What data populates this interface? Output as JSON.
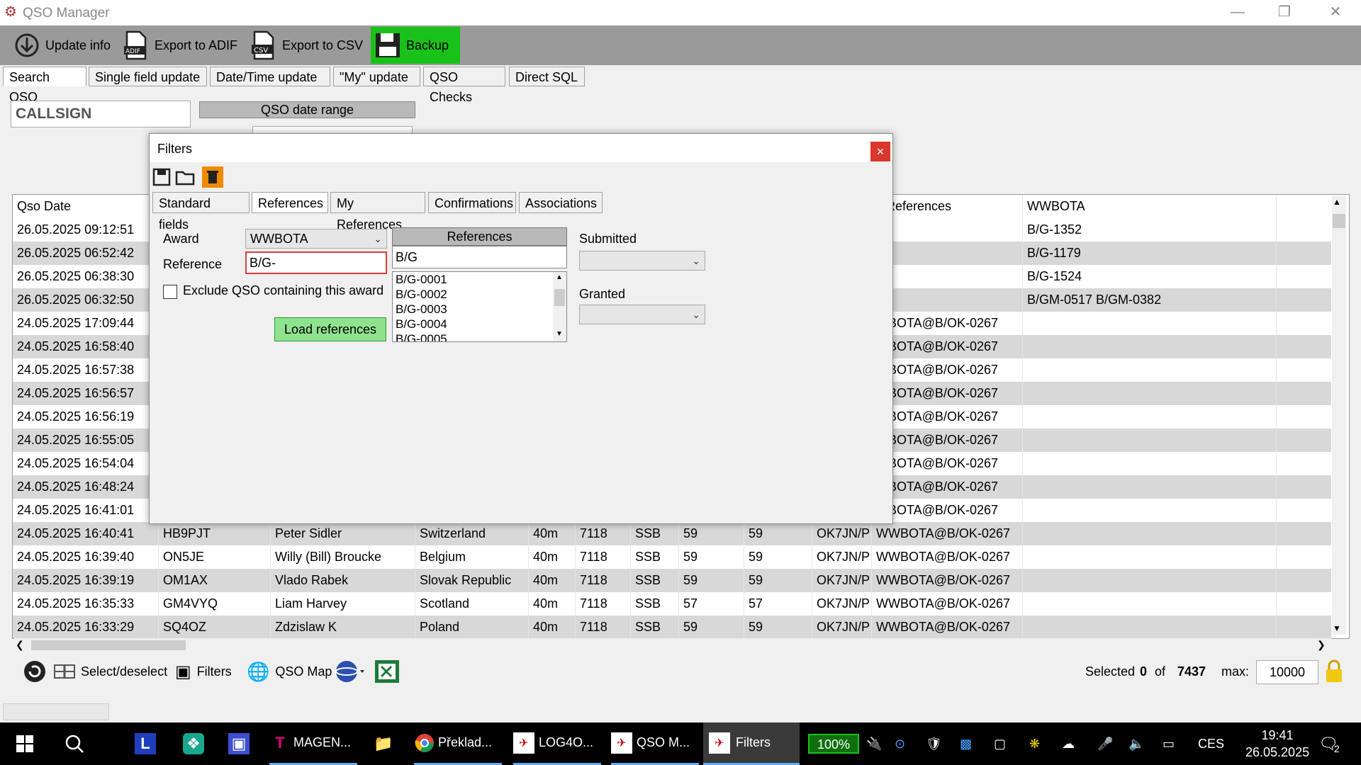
{
  "app": {
    "title": "QSO Manager"
  },
  "toolbar": {
    "update_info": "Update info",
    "export_adif": "Export to ADIF",
    "export_csv": "Export to CSV",
    "backup": "Backup",
    "backup_color": "#19c219"
  },
  "tabs": [
    "Search QSO",
    "Single field update",
    "Date/Time update",
    "\"My\" update",
    "QSO Checks",
    "Direct SQL"
  ],
  "search": {
    "callsign_placeholder": "CALLSIGN",
    "date_range": "QSO date range"
  },
  "grid": {
    "columns": [
      "Qso Date",
      "",
      "",
      "",
      "",
      "",
      "",
      "",
      "",
      "",
      "y References",
      "WWBOTA"
    ],
    "rows": [
      [
        "26.05.2025 09:12:51",
        "",
        "",
        "",
        "",
        "",
        "",
        "",
        "",
        "",
        "",
        "B/G-1352"
      ],
      [
        "26.05.2025 06:52:42",
        "",
        "",
        "",
        "",
        "",
        "",
        "",
        "",
        "",
        "",
        "B/G-1179"
      ],
      [
        "26.05.2025 06:38:30",
        "",
        "",
        "",
        "",
        "",
        "",
        "",
        "",
        "",
        "",
        "B/G-1524"
      ],
      [
        "26.05.2025 06:32:50",
        "",
        "",
        "",
        "",
        "",
        "",
        "",
        "",
        "",
        "",
        "B/GM-0517 B/GM-0382"
      ],
      [
        "24.05.2025 17:09:44",
        "",
        "",
        "",
        "",
        "",
        "",
        "",
        "",
        "",
        "WBOTA@B/OK-0267",
        ""
      ],
      [
        "24.05.2025 16:58:40",
        "",
        "",
        "",
        "",
        "",
        "",
        "",
        "",
        "",
        "WBOTA@B/OK-0267",
        ""
      ],
      [
        "24.05.2025 16:57:38",
        "",
        "",
        "",
        "",
        "",
        "",
        "",
        "",
        "",
        "WBOTA@B/OK-0267",
        ""
      ],
      [
        "24.05.2025 16:56:57",
        "",
        "",
        "",
        "",
        "",
        "",
        "",
        "",
        "",
        "WBOTA@B/OK-0267",
        ""
      ],
      [
        "24.05.2025 16:56:19",
        "",
        "",
        "",
        "",
        "",
        "",
        "",
        "",
        "",
        "WBOTA@B/OK-0267",
        ""
      ],
      [
        "24.05.2025 16:55:05",
        "",
        "",
        "",
        "",
        "",
        "",
        "",
        "",
        "",
        "WBOTA@B/OK-0267",
        ""
      ],
      [
        "24.05.2025 16:54:04",
        "",
        "",
        "",
        "",
        "",
        "",
        "",
        "",
        "",
        "WBOTA@B/OK-0267",
        ""
      ],
      [
        "24.05.2025 16:48:24",
        "",
        "",
        "",
        "",
        "",
        "",
        "",
        "",
        "",
        "WBOTA@B/OK-0267",
        ""
      ],
      [
        "24.05.2025 16:41:01",
        "",
        "",
        "",
        "",
        "",
        "",
        "",
        "",
        "",
        "WBOTA@B/OK-0267",
        ""
      ],
      [
        "24.05.2025 16:40:41",
        "HB9PJT",
        "Peter Sidler",
        "Switzerland",
        "40m",
        "7118",
        "SSB",
        "59",
        "59",
        "OK7JN/P",
        "WWBOTA@B/OK-0267",
        ""
      ],
      [
        "24.05.2025 16:39:40",
        "ON5JE",
        "Willy (Bill) Broucke",
        "Belgium",
        "40m",
        "7118",
        "SSB",
        "59",
        "59",
        "OK7JN/P",
        "WWBOTA@B/OK-0267",
        ""
      ],
      [
        "24.05.2025 16:39:19",
        "OM1AX",
        "Vlado Rabek",
        "Slovak Republic",
        "40m",
        "7118",
        "SSB",
        "59",
        "59",
        "OK7JN/P",
        "WWBOTA@B/OK-0267",
        ""
      ],
      [
        "24.05.2025 16:35:33",
        "GM4VYQ",
        "Liam Harvey",
        "Scotland",
        "40m",
        "7118",
        "SSB",
        "57",
        "57",
        "OK7JN/P",
        "WWBOTA@B/OK-0267",
        ""
      ],
      [
        "24.05.2025 16:33:29",
        "SQ4OZ",
        "Zdzislaw K",
        "Poland",
        "40m",
        "7118",
        "SSB",
        "59",
        "59",
        "OK7JN/P",
        "WWBOTA@B/OK-0267",
        ""
      ]
    ]
  },
  "statusbar": {
    "select_deselect": "Select/deselect",
    "filters": "Filters",
    "qso_map": "QSO Map",
    "selected_label": "Selected",
    "selected_count": "0",
    "of_label": "of",
    "total": "7437",
    "max_label": "max:",
    "max_value": "10000"
  },
  "dialog": {
    "title": "Filters",
    "close": "×",
    "tabs": [
      "Standard fields",
      "References",
      "My References",
      "Confirmations",
      "Associations"
    ],
    "award_label": "Award",
    "award_value": "WWBOTA",
    "reference_label": "Reference",
    "reference_value": "B/G-",
    "exclude_label": "Exclude QSO containing this award",
    "load_button": "Load references",
    "references_header": "References",
    "references_filter": "B/G",
    "references": [
      "B/G-0001",
      "B/G-0002",
      "B/G-0003",
      "B/G-0004",
      "B/G-0005"
    ],
    "submitted_label": "Submitted",
    "granted_label": "Granted"
  },
  "taskbar": {
    "items": [
      "MAGEN...",
      "Překlad...",
      "LOG4O...",
      "QSO M...",
      "Filters"
    ],
    "battery": "100%",
    "lang": "CES",
    "time": "19:41",
    "date": "26.05.2025",
    "notifications": "2"
  }
}
